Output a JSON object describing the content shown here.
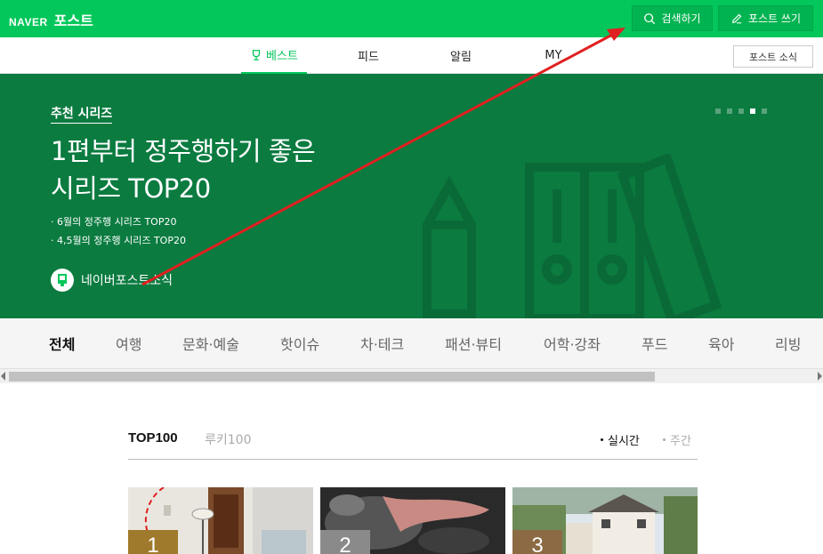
{
  "header": {
    "brand": "NAVER",
    "service": "포스트",
    "search_label": "검색하기",
    "write_label": "포스트 쓰기"
  },
  "nav": {
    "tabs": [
      {
        "label": "베스트",
        "active": true
      },
      {
        "label": "피드",
        "active": false
      },
      {
        "label": "알림",
        "active": false
      },
      {
        "label": "MY",
        "active": false
      }
    ],
    "notice_label": "포스트 소식"
  },
  "banner": {
    "kicker": "추천 시리즈",
    "title_line1": "1편부터 정주행하기 좋은",
    "title_line2": "시리즈 TOP20",
    "bullets": [
      "· 6월의 정주행 시리즈 TOP20",
      "· 4,5월의 정주행 시리즈 TOP20"
    ],
    "author": "네이버포스트소식",
    "slide_count": 5,
    "active_slide": 4,
    "bg_color": "#0b7b40"
  },
  "categories": [
    "전체",
    "여행",
    "문화·예술",
    "핫이슈",
    "차·테크",
    "패션·뷰티",
    "어학·강좌",
    "푸드",
    "육아",
    "리빙"
  ],
  "ranking": {
    "tabs": [
      "TOP100",
      "루키100"
    ],
    "periods": [
      "실시간",
      "주간"
    ],
    "items": [
      {
        "rank": "1",
        "badge_color": "#a07a2c"
      },
      {
        "rank": "2",
        "badge_color": "#8a8a8a"
      },
      {
        "rank": "3",
        "badge_color": "#8b6a44"
      }
    ]
  },
  "colors": {
    "brand_green": "#03c75a",
    "annotation_arrow": "#e02020"
  },
  "icons": [
    "search-icon",
    "pencil-icon",
    "trophy-icon"
  ]
}
